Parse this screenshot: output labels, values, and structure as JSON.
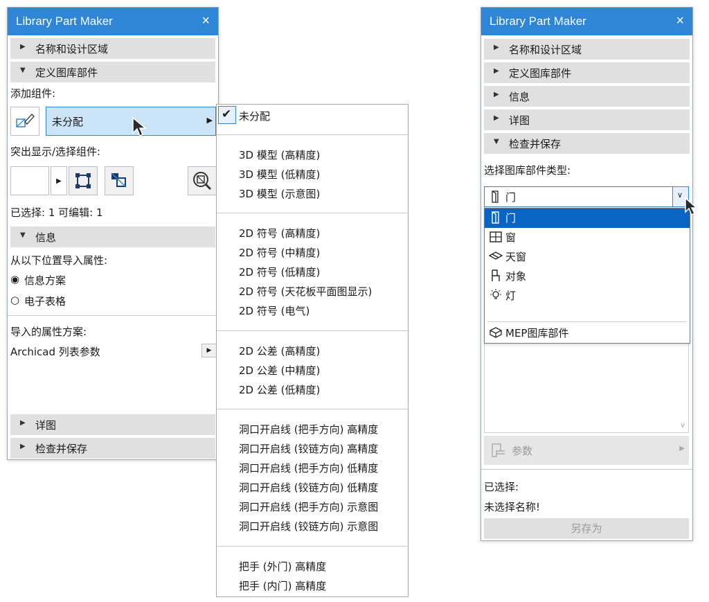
{
  "colors": {
    "title_bar": "#2f86d6",
    "selection": "#cce4f7",
    "dropdown_highlight": "#0a64c4",
    "section_bg": "#e0e0e0"
  },
  "left_panel": {
    "title": "Library Part Maker",
    "close_glyph": "×",
    "section_name_design": "名称和设计区域",
    "section_define": "定义图库部件",
    "add_component_label": "添加组件:",
    "component_select_value": "未分配",
    "highlight_select_label": "突出显示/选择组件:",
    "selected_editable": "已选择: 1 可编辑: 1",
    "section_info": "信息",
    "import_from_label": "从以下位置导入属性:",
    "radio_info_scheme": "信息方案",
    "radio_spreadsheet": "电子表格",
    "imported_scheme_label": "导入的属性方案:",
    "imported_scheme_value": "Archicad 列表参数",
    "section_details": "详图",
    "section_check_save": "检查并保存"
  },
  "component_menu": {
    "checked_item": "未分配",
    "group_3d": [
      "3D 模型 (高精度)",
      "3D 模型 (低精度)",
      "3D 模型 (示意图)"
    ],
    "group_2d_symbol": [
      "2D 符号 (高精度)",
      "2D 符号 (中精度)",
      "2D 符号 (低精度)",
      "2D 符号 (天花板平面图显示)",
      "2D 符号 (电气)"
    ],
    "group_2d_tolerance": [
      "2D 公差 (高精度)",
      "2D 公差 (中精度)",
      "2D 公差 (低精度)"
    ],
    "group_opening_lines": [
      "洞口开启线 (把手方向) 高精度",
      "洞口开启线 (铰链方向) 高精度",
      "洞口开启线 (把手方向) 低精度",
      "洞口开启线 (铰链方向) 低精度",
      "洞口开启线 (把手方向) 示意图",
      "洞口开启线 (铰链方向) 示意图"
    ],
    "group_handles": [
      "把手 (外门) 高精度",
      "把手 (内门) 高精度"
    ]
  },
  "right_panel": {
    "title": "Library Part Maker",
    "close_glyph": "×",
    "section_name_design": "名称和设计区域",
    "section_define": "定义图库部件",
    "section_info": "信息",
    "section_details": "详图",
    "section_check_save": "检查并保存",
    "part_type_label": "选择图库部件类型:",
    "type_select_value": "门",
    "type_options": [
      {
        "label": "门",
        "icon": "door-icon"
      },
      {
        "label": "窗",
        "icon": "window-icon"
      },
      {
        "label": "天窗",
        "icon": "skylight-icon"
      },
      {
        "label": "对象",
        "icon": "object-icon"
      },
      {
        "label": "灯",
        "icon": "lamp-icon"
      },
      {
        "label": "MEP图库部件",
        "icon": "mep-icon"
      }
    ],
    "params_button": "参数",
    "selected_label": "已选择:",
    "no_name_selected": "未选择名称!",
    "save_as_button": "另存为"
  }
}
